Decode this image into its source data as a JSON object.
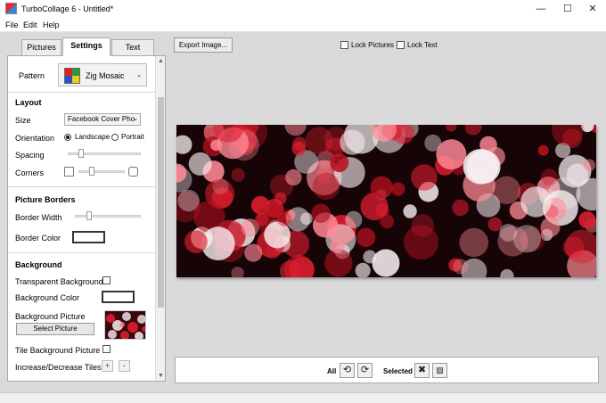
{
  "window": {
    "title": "TurboCollage 6 - Untitled*",
    "icon": "turbocollage-app-icon",
    "controls": {
      "minimize": "—",
      "maximize": "☐",
      "close": "✕"
    }
  },
  "menu": [
    "File",
    "Edit",
    "Help"
  ],
  "tabs": [
    "Pictures",
    "Settings",
    "Text"
  ],
  "active_tab": "Settings",
  "settings": {
    "pattern_label": "Pattern",
    "pattern_value": "Zig Mosaic",
    "layout": {
      "title": "Layout",
      "size_label": "Size",
      "size_value": "Facebook Cover Pho",
      "orientation_label": "Orientation",
      "orientation_options": [
        "Landscape",
        "Portrait"
      ],
      "orientation_selected": "Landscape",
      "spacing_label": "Spacing",
      "spacing_level": 0.2,
      "corners_label": "Corners",
      "corners_level": 0.4
    },
    "borders": {
      "title": "Picture Borders",
      "width_label": "Border Width",
      "width_level": 0.2,
      "color_label": "Border Color",
      "color": "#ffffff"
    },
    "background": {
      "title": "Background",
      "transparent_label": "Transparent Background",
      "transparent_checked": false,
      "color_label": "Background Color",
      "color": "#ffffff",
      "picture_label": "Background Picture",
      "select_button": "Select Picture",
      "tile_label": "Tile Background Picture",
      "tile_checked": false,
      "tiles_label": "Increase/Decrease Tiles",
      "plus": "+",
      "minus": "-"
    }
  },
  "toolbar": {
    "export_button": "Export Image...",
    "lock_pictures": "Lock Pictures",
    "lock_text": "Lock Text"
  },
  "bottombar": {
    "all_label": "All",
    "selected_label": "Selected",
    "rotate_ccw_icon": "rotate-left-icon",
    "rotate_cw_icon": "rotate-right-icon",
    "delete_icon": "delete-icon",
    "image_icon": "image-icon"
  },
  "colors": {
    "workspace": "#dadada",
    "canvas_bg": "#160406",
    "bokeh_red": "#e01e30",
    "bokeh_white": "#f6eef0"
  }
}
